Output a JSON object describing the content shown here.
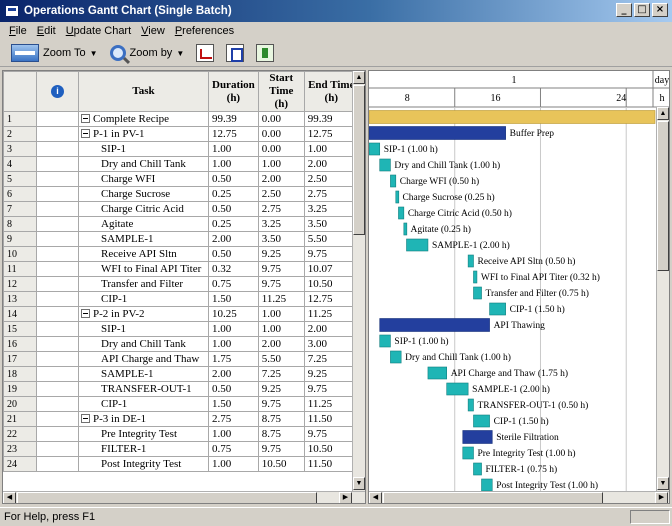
{
  "window": {
    "title": "Operations Gantt Chart (Single Batch)"
  },
  "menu": [
    {
      "label": "File",
      "key": "F",
      "rest": "ile"
    },
    {
      "label": "Edit",
      "key": "E",
      "rest": "dit"
    },
    {
      "label": "Update Chart",
      "key": "U",
      "rest": "pdate Chart"
    },
    {
      "label": "View",
      "key": "V",
      "rest": "iew"
    },
    {
      "label": "Preferences",
      "key": "P",
      "rest": "references"
    }
  ],
  "toolbar": {
    "zoom_to": "Zoom To",
    "zoom_by": "Zoom by"
  },
  "grid": {
    "headers": {
      "task": "Task",
      "duration": "Duration (h)",
      "start": "Start Time (h)",
      "end": "End Time (h)"
    },
    "rows": [
      {
        "num": "1",
        "task": "Complete Recipe",
        "level": 0,
        "group": true,
        "duration": "99.39",
        "start": "0.00",
        "end": "99.39"
      },
      {
        "num": "2",
        "task": "P-1 in PV-1",
        "level": 0,
        "group": true,
        "duration": "12.75",
        "start": "0.00",
        "end": "12.75"
      },
      {
        "num": "3",
        "task": "SIP-1",
        "level": 1,
        "group": false,
        "duration": "1.00",
        "start": "0.00",
        "end": "1.00"
      },
      {
        "num": "4",
        "task": "Dry and Chill Tank",
        "level": 1,
        "group": false,
        "duration": "1.00",
        "start": "1.00",
        "end": "2.00"
      },
      {
        "num": "5",
        "task": "Charge WFI",
        "level": 1,
        "group": false,
        "duration": "0.50",
        "start": "2.00",
        "end": "2.50"
      },
      {
        "num": "6",
        "task": "Charge Sucrose",
        "level": 1,
        "group": false,
        "duration": "0.25",
        "start": "2.50",
        "end": "2.75"
      },
      {
        "num": "7",
        "task": "Charge Citric Acid",
        "level": 1,
        "group": false,
        "duration": "0.50",
        "start": "2.75",
        "end": "3.25"
      },
      {
        "num": "8",
        "task": "Agitate",
        "level": 1,
        "group": false,
        "duration": "0.25",
        "start": "3.25",
        "end": "3.50"
      },
      {
        "num": "9",
        "task": "SAMPLE-1",
        "level": 1,
        "group": false,
        "duration": "2.00",
        "start": "3.50",
        "end": "5.50"
      },
      {
        "num": "10",
        "task": "Receive API Sltn",
        "level": 1,
        "group": false,
        "duration": "0.50",
        "start": "9.25",
        "end": "9.75"
      },
      {
        "num": "11",
        "task": "WFI to Final API Titer",
        "level": 1,
        "group": false,
        "duration": "0.32",
        "start": "9.75",
        "end": "10.07"
      },
      {
        "num": "12",
        "task": "Transfer and Filter",
        "level": 1,
        "group": false,
        "duration": "0.75",
        "start": "9.75",
        "end": "10.50"
      },
      {
        "num": "13",
        "task": "CIP-1",
        "level": 1,
        "group": false,
        "duration": "1.50",
        "start": "11.25",
        "end": "12.75"
      },
      {
        "num": "14",
        "task": "P-2 in PV-2",
        "level": 0,
        "group": true,
        "duration": "10.25",
        "start": "1.00",
        "end": "11.25"
      },
      {
        "num": "15",
        "task": "SIP-1",
        "level": 1,
        "group": false,
        "duration": "1.00",
        "start": "1.00",
        "end": "2.00"
      },
      {
        "num": "16",
        "task": "Dry and Chill Tank",
        "level": 1,
        "group": false,
        "duration": "1.00",
        "start": "2.00",
        "end": "3.00"
      },
      {
        "num": "17",
        "task": "API Charge and Thaw",
        "level": 1,
        "group": false,
        "duration": "1.75",
        "start": "5.50",
        "end": "7.25"
      },
      {
        "num": "18",
        "task": "SAMPLE-1",
        "level": 1,
        "group": false,
        "duration": "2.00",
        "start": "7.25",
        "end": "9.25"
      },
      {
        "num": "19",
        "task": "TRANSFER-OUT-1",
        "level": 1,
        "group": false,
        "duration": "0.50",
        "start": "9.25",
        "end": "9.75"
      },
      {
        "num": "20",
        "task": "CIP-1",
        "level": 1,
        "group": false,
        "duration": "1.50",
        "start": "9.75",
        "end": "11.25"
      },
      {
        "num": "21",
        "task": "P-3 in DE-1",
        "level": 0,
        "group": true,
        "duration": "2.75",
        "start": "8.75",
        "end": "11.50"
      },
      {
        "num": "22",
        "task": "Pre Integrity Test",
        "level": 1,
        "group": false,
        "duration": "1.00",
        "start": "8.75",
        "end": "9.75"
      },
      {
        "num": "23",
        "task": "FILTER-1",
        "level": 1,
        "group": false,
        "duration": "0.75",
        "start": "9.75",
        "end": "10.50"
      },
      {
        "num": "24",
        "task": "Post Integrity Test",
        "level": 1,
        "group": false,
        "duration": "1.00",
        "start": "10.50",
        "end": "11.50"
      }
    ]
  },
  "gantt": {
    "time_header": {
      "top_value": "1",
      "ticks": [
        "8",
        "16",
        "24"
      ],
      "unit_top": "day",
      "unit_bottom": "h"
    },
    "axis": {
      "min": 0,
      "max": 26.5
    },
    "colors": {
      "recipe": "#e8c45a",
      "group": "#233f9e",
      "task": "#1fb5b5",
      "grid": "#c8c8c8"
    },
    "bars": [
      {
        "row": 0,
        "kind": "recipe",
        "start": 0,
        "end": 99.39,
        "label": ""
      },
      {
        "row": 1,
        "kind": "group",
        "start": 0,
        "end": 12.75,
        "label": "Buffer Prep"
      },
      {
        "row": 2,
        "kind": "task",
        "start": 0,
        "end": 1,
        "label": "SIP-1 (1.00 h)"
      },
      {
        "row": 3,
        "kind": "task",
        "start": 1,
        "end": 2,
        "label": "Dry and Chill Tank (1.00 h)"
      },
      {
        "row": 4,
        "kind": "task",
        "start": 2,
        "end": 2.5,
        "label": "Charge WFI (0.50 h)"
      },
      {
        "row": 5,
        "kind": "task",
        "start": 2.5,
        "end": 2.75,
        "label": "Charge Sucrose (0.25 h)"
      },
      {
        "row": 6,
        "kind": "task",
        "start": 2.75,
        "end": 3.25,
        "label": "Charge Citric Acid (0.50 h)"
      },
      {
        "row": 7,
        "kind": "task",
        "start": 3.25,
        "end": 3.5,
        "label": "Agitate (0.25 h)"
      },
      {
        "row": 8,
        "kind": "task",
        "start": 3.5,
        "end": 5.5,
        "label": "SAMPLE-1 (2.00 h)"
      },
      {
        "row": 9,
        "kind": "task",
        "start": 9.25,
        "end": 9.75,
        "label": "Receive API Sltn (0.50 h)"
      },
      {
        "row": 10,
        "kind": "task",
        "start": 9.75,
        "end": 10.07,
        "label": "WFI to Final API Titer (0.32 h)"
      },
      {
        "row": 11,
        "kind": "task",
        "start": 9.75,
        "end": 10.5,
        "label": "Transfer and Filter (0.75 h)"
      },
      {
        "row": 12,
        "kind": "task",
        "start": 11.25,
        "end": 12.75,
        "label": "CIP-1 (1.50 h)"
      },
      {
        "row": 13,
        "kind": "group",
        "start": 1,
        "end": 11.25,
        "label": "API Thawing"
      },
      {
        "row": 14,
        "kind": "task",
        "start": 1,
        "end": 2,
        "label": "SIP-1 (1.00 h)"
      },
      {
        "row": 15,
        "kind": "task",
        "start": 2,
        "end": 3,
        "label": "Dry and Chill Tank (1.00 h)"
      },
      {
        "row": 16,
        "kind": "task",
        "start": 5.5,
        "end": 7.25,
        "label": "API Charge and Thaw (1.75 h)"
      },
      {
        "row": 17,
        "kind": "task",
        "start": 7.25,
        "end": 9.25,
        "label": "SAMPLE-1 (2.00 h)"
      },
      {
        "row": 18,
        "kind": "task",
        "start": 9.25,
        "end": 9.75,
        "label": "TRANSFER-OUT-1 (0.50 h)"
      },
      {
        "row": 19,
        "kind": "task",
        "start": 9.75,
        "end": 11.25,
        "label": "CIP-1 (1.50 h)"
      },
      {
        "row": 20,
        "kind": "group",
        "start": 8.75,
        "end": 11.5,
        "label": "Sterile Filtration"
      },
      {
        "row": 21,
        "kind": "task",
        "start": 8.75,
        "end": 9.75,
        "label": "Pre Integrity Test (1.00 h)"
      },
      {
        "row": 22,
        "kind": "task",
        "start": 9.75,
        "end": 10.5,
        "label": "FILTER-1 (0.75 h)"
      },
      {
        "row": 23,
        "kind": "task",
        "start": 10.5,
        "end": 11.5,
        "label": "Post Integrity Test (1.00 h)"
      }
    ]
  },
  "status": {
    "text": "For Help, press F1"
  }
}
